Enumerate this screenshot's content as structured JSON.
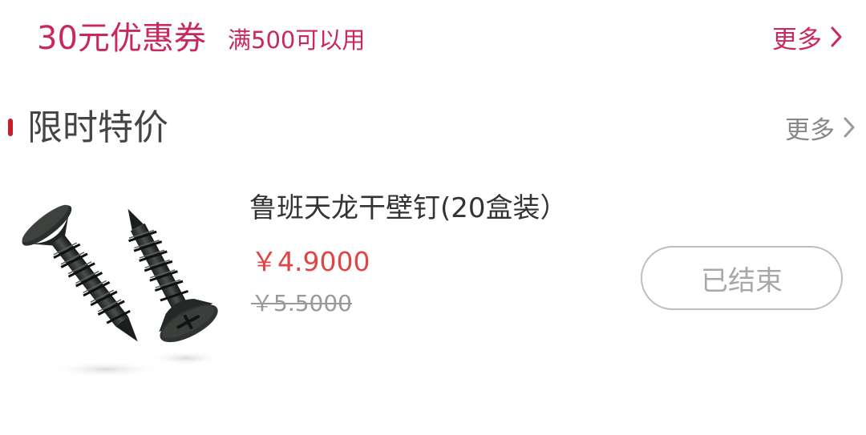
{
  "coupon": {
    "amount": "30元优惠券",
    "condition": "满500可以用",
    "more_label": "更多",
    "more_icon": "chevron-right-icon"
  },
  "flash_sale": {
    "title": "限时特价",
    "more_label": "更多",
    "more_icon": "chevron-right-icon",
    "products": [
      {
        "name": "鲁班天龙干壁钉(20盒装）",
        "price": "￥4.9000",
        "original_price": "￥5.5000",
        "status_label": "已结束",
        "image_icon": "drywall-screws-image"
      }
    ]
  },
  "colors": {
    "coupon_accent": "#c8285c",
    "section_accent": "#c41e2a",
    "price": "#e04545",
    "muted": "#999999"
  }
}
